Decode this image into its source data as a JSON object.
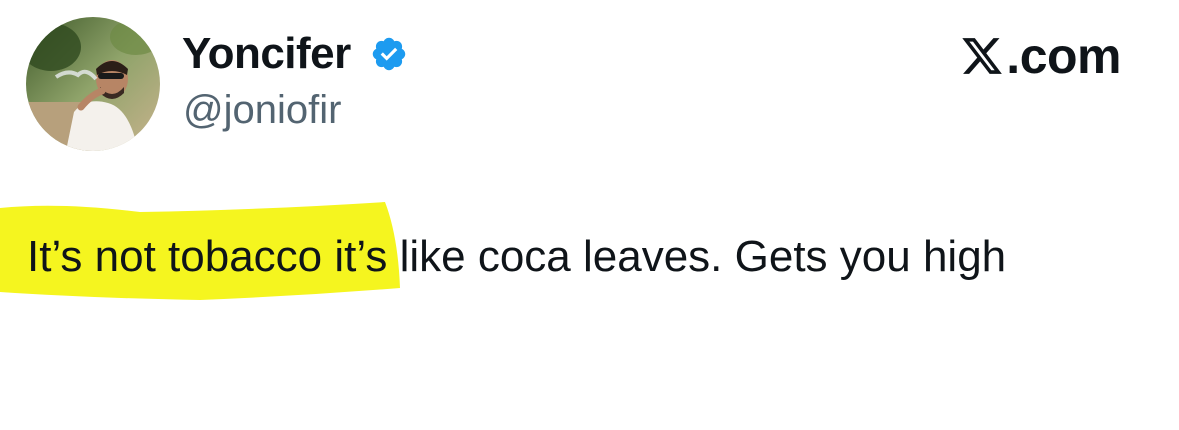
{
  "tweet": {
    "author": {
      "display_name": "Yoncifer",
      "handle": "@joniofir",
      "verified": true,
      "avatar_icon": "profile-photo"
    },
    "source_label": ".com",
    "brand_icon": "x-logo-icon",
    "text_highlighted": "It’s not tobacco",
    "text_rest": " it’s like coca leaves. Gets you high",
    "highlight_color": "#f5f51f",
    "verified_color": "#1d9bf0",
    "handle_color": "#536471"
  }
}
